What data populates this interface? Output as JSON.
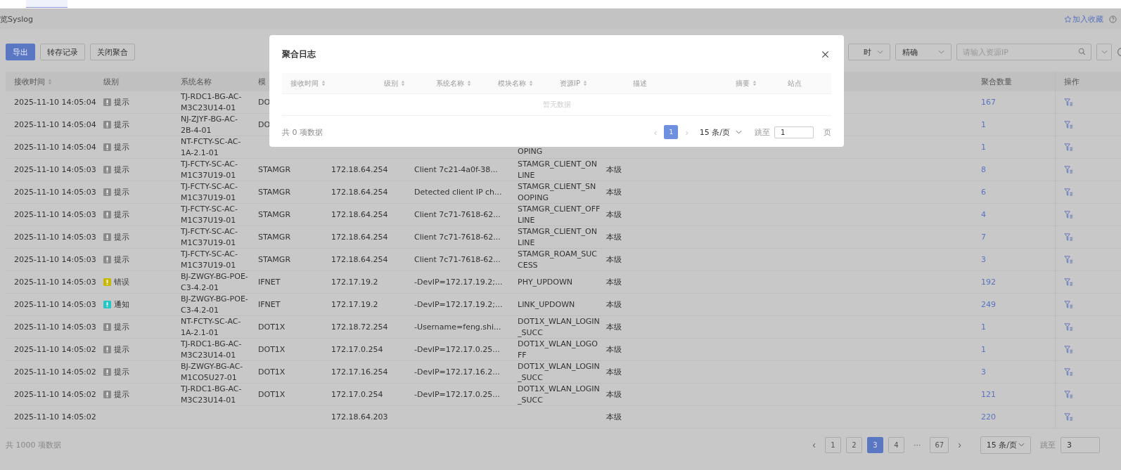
{
  "page_title": "览Syslog",
  "favorite": {
    "label": "加入收藏"
  },
  "toolbar": {
    "buttons": [
      {
        "label": "导出",
        "primary": true
      },
      {
        "label": "转存记录",
        "primary": false
      },
      {
        "label": "关闭聚合",
        "primary": false
      }
    ],
    "selects": [
      {
        "value": "时"
      },
      {
        "value": "精确"
      }
    ],
    "search": {
      "placeholder": "请输入资源IP"
    }
  },
  "table": {
    "columns": [
      {
        "label": "接收时间",
        "sortable": true
      },
      {
        "label": "级别",
        "sortable": false
      },
      {
        "label": "系统名称",
        "sortable": false
      },
      {
        "label": "模"
      },
      {
        "label": "聚合数量",
        "sortable": false
      },
      {
        "label": "操作",
        "sortable": false
      }
    ],
    "rows": [
      {
        "time": "2025-11-10 14:05:04",
        "level": {
          "label": "提示",
          "color": "#8a8a8a"
        },
        "system": "TJ-RDC1-BG-AC-M3C23U14-01",
        "module": "DO",
        "count": "167"
      },
      {
        "time": "2025-11-10 14:05:04",
        "level": {
          "label": "提示",
          "color": "#8a8a8a"
        },
        "system": "NJ-ZJYF-BG-AC-2B-4-01",
        "module": "DO",
        "count": "1"
      },
      {
        "time": "2025-11-10 14:05:04",
        "level": {
          "label": "提示",
          "color": "#8a8a8a"
        },
        "system": "NT-FCTY-SC-AC-1A-2.1-01",
        "summary_tail": "OPING",
        "count": "1"
      },
      {
        "time": "2025-11-10 14:05:03",
        "level": {
          "label": "提示",
          "color": "#8a8a8a"
        },
        "system": "TJ-FCTY-SC-AC-M1C37U19-01",
        "module": "STAMGR",
        "ip": "172.18.64.254",
        "desc": "Client 7c21-4a0f-38...",
        "summary": "STAMGR_CLIENT_ONLINE",
        "site": "本级",
        "count": "8"
      },
      {
        "time": "2025-11-10 14:05:03",
        "level": {
          "label": "提示",
          "color": "#8a8a8a"
        },
        "system": "TJ-FCTY-SC-AC-M1C37U19-01",
        "module": "STAMGR",
        "ip": "172.18.64.254",
        "desc": "Detected client IP ch...",
        "summary": "STAMGR_CLIENT_SNOOPING",
        "site": "本级",
        "count": "6"
      },
      {
        "time": "2025-11-10 14:05:03",
        "level": {
          "label": "提示",
          "color": "#8a8a8a"
        },
        "system": "TJ-FCTY-SC-AC-M1C37U19-01",
        "module": "STAMGR",
        "ip": "172.18.64.254",
        "desc": "Client 7c71-7618-62...",
        "summary": "STAMGR_CLIENT_OFFLINE",
        "site": "本级",
        "count": "4"
      },
      {
        "time": "2025-11-10 14:05:03",
        "level": {
          "label": "提示",
          "color": "#8a8a8a"
        },
        "system": "TJ-FCTY-SC-AC-M1C37U19-01",
        "module": "STAMGR",
        "ip": "172.18.64.254",
        "desc": "Client 7c71-7618-62...",
        "summary": "STAMGR_CLIENT_ONLINE",
        "site": "本级",
        "count": "7"
      },
      {
        "time": "2025-11-10 14:05:03",
        "level": {
          "label": "提示",
          "color": "#8a8a8a"
        },
        "system": "TJ-FCTY-SC-AC-M1C37U19-01",
        "module": "STAMGR",
        "ip": "172.18.64.254",
        "desc": "Client 7c71-7618-62...",
        "summary": "STAMGR_ROAM_SUCCESS",
        "site": "本级",
        "count": "3"
      },
      {
        "time": "2025-11-10 14:05:03",
        "level": {
          "label": "错误",
          "color": "#c9b800"
        },
        "system": "BJ-ZWGY-BG-POE-C3-4.2-01",
        "module": "IFNET",
        "ip": "172.17.19.2",
        "desc": "-DevIP=172.17.19.2;...",
        "summary": "PHY_UPDOWN",
        "site": "本级",
        "count": "192"
      },
      {
        "time": "2025-11-10 14:05:03",
        "level": {
          "label": "通知",
          "color": "#22c6c6"
        },
        "system": "BJ-ZWGY-BG-POE-C3-4.2-01",
        "module": "IFNET",
        "ip": "172.17.19.2",
        "desc": "-DevIP=172.17.19.2;...",
        "summary": "LINK_UPDOWN",
        "site": "本级",
        "count": "249"
      },
      {
        "time": "2025-11-10 14:05:03",
        "level": {
          "label": "提示",
          "color": "#8a8a8a"
        },
        "system": "NT-FCTY-SC-AC-1A-2.1-01",
        "module": "DOT1X",
        "ip": "172.18.72.254",
        "desc": "-Username=feng.shi...",
        "summary": "DOT1X_WLAN_LOGIN_SUCC",
        "site": "本级",
        "count": "1"
      },
      {
        "time": "2025-11-10 14:05:02",
        "level": {
          "label": "提示",
          "color": "#8a8a8a"
        },
        "system": "TJ-RDC1-BG-AC-M3C23U14-01",
        "module": "DOT1X",
        "ip": "172.17.0.254",
        "desc": "-DevIP=172.17.0.25...",
        "summary": "DOT1X_WLAN_LOGOFF",
        "site": "本级",
        "count": "1"
      },
      {
        "time": "2025-11-10 14:05:02",
        "level": {
          "label": "提示",
          "color": "#8a8a8a"
        },
        "system": "BJ-ZWGY-BG-AC-M1CO5U27-01",
        "module": "DOT1X",
        "ip": "172.17.16.254",
        "desc": "-DevIP=172.17.16.2...",
        "summary": "DOT1X_WLAN_LOGIN_SUCC",
        "site": "本级",
        "count": "3"
      },
      {
        "time": "2025-11-10 14:05:02",
        "level": {
          "label": "提示",
          "color": "#8a8a8a"
        },
        "system": "TJ-RDC1-BG-AC-M3C23U14-01",
        "module": "DOT1X",
        "ip": "172.17.0.254",
        "desc": "-DevIP=172.17.0.25...",
        "summary": "DOT1X_WLAN_LOGIN_SUCC",
        "site": "本级",
        "count": "121"
      },
      {
        "time": "2025-11-10 14:05:02",
        "ip": "172.18.64.203",
        "site": "本级",
        "count": "220"
      }
    ]
  },
  "footer": {
    "total": "共 1000 项数据",
    "prev": "‹",
    "next": "›",
    "pages": [
      {
        "label": "1",
        "kind": "page",
        "selected": false
      },
      {
        "label": "2",
        "kind": "page",
        "selected": false
      },
      {
        "label": "3",
        "kind": "page",
        "selected": true
      },
      {
        "label": "4",
        "kind": "page",
        "selected": false
      },
      {
        "label": "···",
        "kind": "ellipsis",
        "selected": false
      },
      {
        "label": "67",
        "kind": "page",
        "selected": false
      }
    ],
    "page_size": "15 条/页",
    "jump_label": "跳至",
    "jump_value": "3"
  },
  "modal": {
    "title": "聚合日志",
    "columns": [
      {
        "label": "接收时间",
        "sortable": true
      },
      {
        "label": "级别",
        "sortable": true
      },
      {
        "label": "系统名称",
        "sortable": true
      },
      {
        "label": "模块名称",
        "sortable": true
      },
      {
        "label": "资源IP",
        "sortable": true
      },
      {
        "label": "描述",
        "sortable": false
      },
      {
        "label": "摘要",
        "sortable": true
      },
      {
        "label": "站点",
        "sortable": false
      }
    ],
    "empty": "暂无数据",
    "total": "共 0 项数据",
    "prev": "‹",
    "next": "›",
    "pages": [
      {
        "label": "1",
        "selected": true
      }
    ],
    "page_size": "15 条/页",
    "jump_label": "跳至",
    "jump_value": "1",
    "page_suffix": "页"
  }
}
